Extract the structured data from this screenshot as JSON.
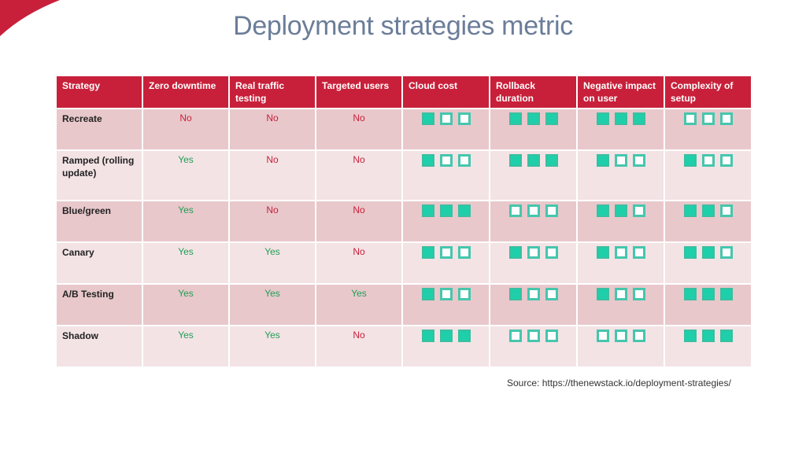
{
  "title": "Deployment strategies metric",
  "colors": {
    "header_bg": "#c8203a",
    "yes": "#1f9e55",
    "no": "#c8203a",
    "filled": "#1ecfaa",
    "title": "#6b7d99"
  },
  "table": {
    "headers": [
      "Strategy",
      "Zero downtime",
      "Real traffic testing",
      "Targeted users",
      "Cloud cost",
      "Rollback duration",
      "Negative impact on user",
      "Complexity of setup"
    ],
    "rating_scale_max": 3,
    "rows": [
      {
        "strategy": "Recreate",
        "zero_downtime": "No",
        "real_traffic_testing": "No",
        "targeted_users": "No",
        "cloud_cost": 1,
        "rollback_duration": 3,
        "negative_impact": 3,
        "complexity": 0
      },
      {
        "strategy": "Ramped (rolling update)",
        "zero_downtime": "Yes",
        "real_traffic_testing": "No",
        "targeted_users": "No",
        "cloud_cost": 1,
        "rollback_duration": 3,
        "negative_impact": 1,
        "complexity": 1
      },
      {
        "strategy": "Blue/green",
        "zero_downtime": "Yes",
        "real_traffic_testing": "No",
        "targeted_users": "No",
        "cloud_cost": 3,
        "rollback_duration": 0,
        "negative_impact": 2,
        "complexity": 2
      },
      {
        "strategy": "Canary",
        "zero_downtime": "Yes",
        "real_traffic_testing": "Yes",
        "targeted_users": "No",
        "cloud_cost": 1,
        "rollback_duration": 1,
        "negative_impact": 1,
        "complexity": 2
      },
      {
        "strategy": "A/B Testing",
        "zero_downtime": "Yes",
        "real_traffic_testing": "Yes",
        "targeted_users": "Yes",
        "cloud_cost": 1,
        "rollback_duration": 1,
        "negative_impact": 1,
        "complexity": 3
      },
      {
        "strategy": "Shadow",
        "zero_downtime": "Yes",
        "real_traffic_testing": "Yes",
        "targeted_users": "No",
        "cloud_cost": 3,
        "rollback_duration": 0,
        "negative_impact": 0,
        "complexity": 3
      }
    ]
  },
  "source": "Source: https://thenewstack.io/deployment-strategies/"
}
